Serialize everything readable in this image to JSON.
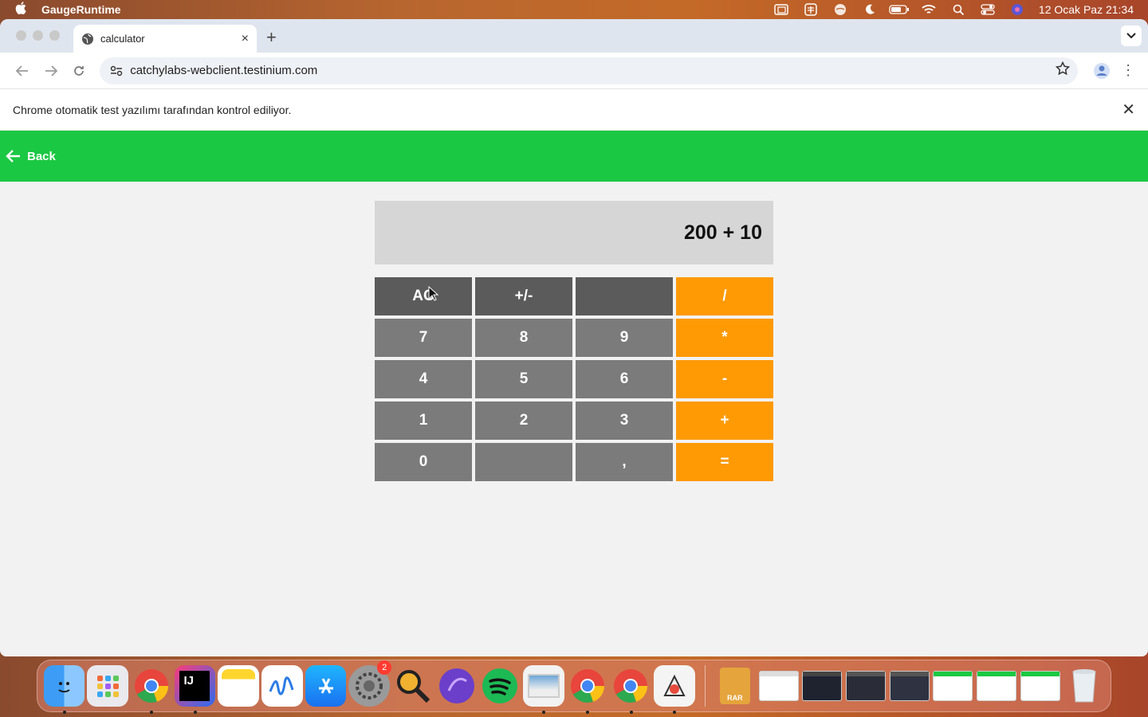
{
  "menubar": {
    "app_name": "GaugeRuntime",
    "clock": "12 Ocak Paz  21:34"
  },
  "tab": {
    "title": "calculator",
    "close": "×",
    "new": "+"
  },
  "address": {
    "url": "catchylabs-webclient.testinium.com"
  },
  "infobar": {
    "text": "Chrome otomatik test yazılımı tarafından kontrol ediliyor."
  },
  "app_header": {
    "back_label": "Back"
  },
  "calculator": {
    "display": "200 + 10",
    "keys": [
      "AC",
      "+/-",
      "",
      "/",
      "7",
      "8",
      "9",
      "*",
      "4",
      "5",
      "6",
      "-",
      "1",
      "2",
      "3",
      "+",
      "0",
      "",
      ",",
      "="
    ]
  },
  "dock": {
    "settings_badge": "2",
    "archive_label": "RAR"
  },
  "colors": {
    "header_green": "#1bc843",
    "operator_orange": "#ff9a05",
    "key_gray": "#7b7b7b",
    "key_dark": "#5b5b5b"
  }
}
